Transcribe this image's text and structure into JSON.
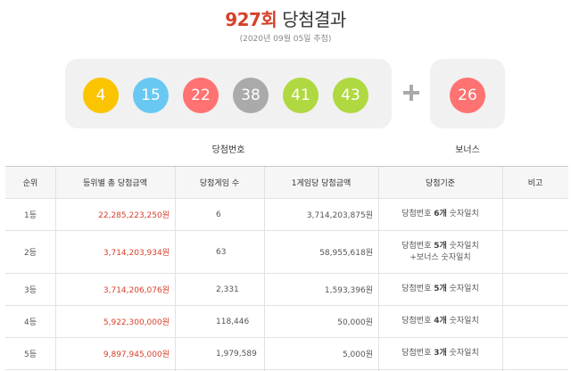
{
  "header": {
    "round": "927회",
    "title_suffix": " 당첨결과",
    "date": "(2020년 09월 05일 추첨)"
  },
  "win_numbers": {
    "label": "당첨번호",
    "balls": [
      {
        "number": "4",
        "color": "#fbc400"
      },
      {
        "number": "15",
        "color": "#69c8f2"
      },
      {
        "number": "22",
        "color": "#ff7272"
      },
      {
        "number": "38",
        "color": "#aaaaaa"
      },
      {
        "number": "41",
        "color": "#b0d840"
      },
      {
        "number": "43",
        "color": "#b0d840"
      }
    ]
  },
  "bonus": {
    "label": "보너스",
    "number": "26",
    "color": "#ff7272"
  },
  "table": {
    "headers": [
      "순위",
      "등위별 총 당첨금액",
      "당첨게임 수",
      "1게임당 당첨금액",
      "당첨기준",
      "비고"
    ],
    "rows": [
      {
        "rank": "1등",
        "total": "22,285,223,250원",
        "games": "6",
        "per_game": "3,714,203,875원",
        "criteria_pre": "당첨번호 ",
        "criteria_bold": "6개",
        "criteria_post": " 숫자일치",
        "criteria2": ""
      },
      {
        "rank": "2등",
        "total": "3,714,203,934원",
        "games": "63",
        "per_game": "58,955,618원",
        "criteria_pre": "당첨번호 ",
        "criteria_bold": "5개",
        "criteria_post": " 숫자일치",
        "criteria2": "+보너스 숫자일치"
      },
      {
        "rank": "3등",
        "total": "3,714,206,076원",
        "games": "2,331",
        "per_game": "1,593,396원",
        "criteria_pre": "당첨번호 ",
        "criteria_bold": "5개",
        "criteria_post": " 숫자일치",
        "criteria2": ""
      },
      {
        "rank": "4등",
        "total": "5,922,300,000원",
        "games": "118,446",
        "per_game": "50,000원",
        "criteria_pre": "당첨번호 ",
        "criteria_bold": "4개",
        "criteria_post": " 숫자일치",
        "criteria2": ""
      },
      {
        "rank": "5등",
        "total": "9,897,945,000원",
        "games": "1,979,589",
        "per_game": "5,000원",
        "criteria_pre": "당첨번호 ",
        "criteria_bold": "3개",
        "criteria_post": " 숫자일치",
        "criteria2": ""
      }
    ]
  }
}
